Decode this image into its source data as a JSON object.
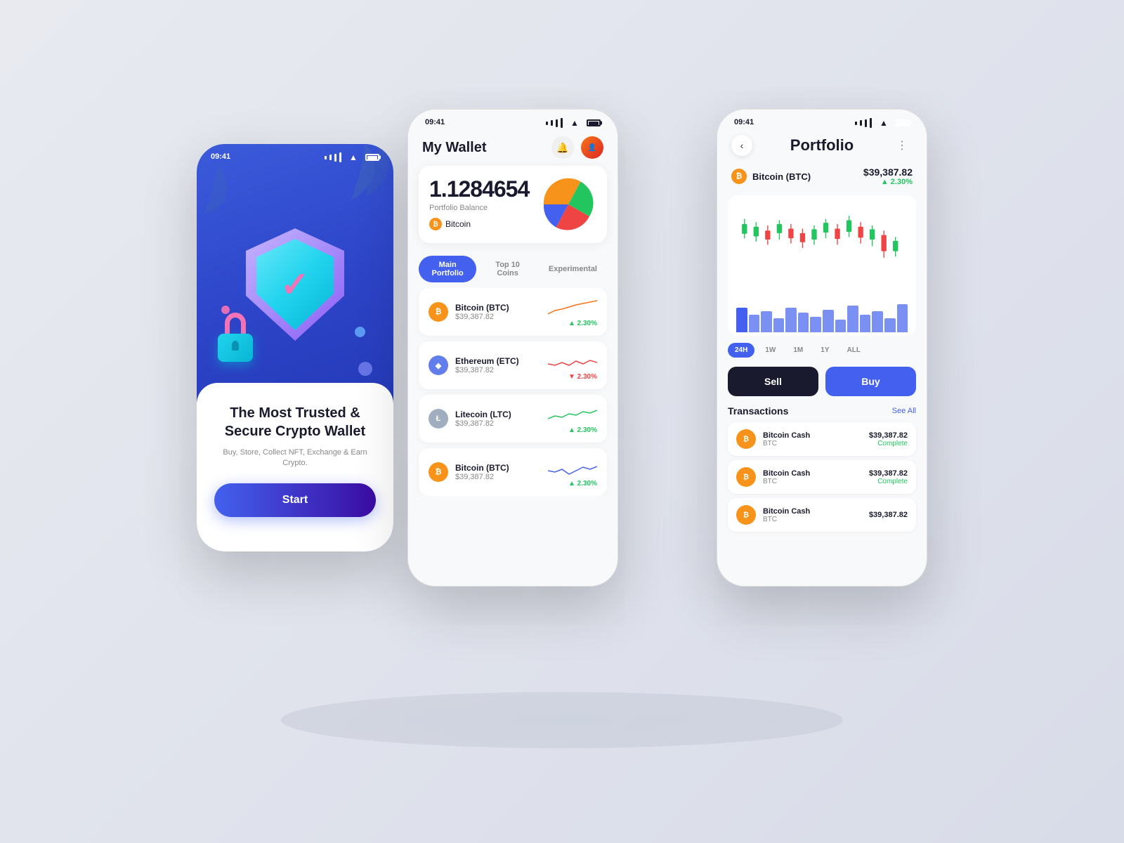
{
  "leftPhone": {
    "statusTime": "09:41",
    "headline": "The Most Trusted & Secure Crypto Wallet",
    "subtext": "Buy, Store, Collect NFT, Exchange & Earn Crypto.",
    "startBtn": "Start"
  },
  "middlePhone": {
    "statusTime": "09:41",
    "title": "My Wallet",
    "portfolio": {
      "balance": "1.1284654",
      "label": "Portfolio Balance",
      "currency": "Bitcoin"
    },
    "tabs": [
      "Main Portfolio",
      "Top 10 Coins",
      "Experimental"
    ],
    "activeTab": 0,
    "coins": [
      {
        "name": "Bitcoin (BTC)",
        "price": "$39,387.82",
        "change": "▲ 2.30%",
        "positive": true,
        "type": "btc"
      },
      {
        "name": "Ethereum (ETC)",
        "price": "$39,387.82",
        "change": "▼ 2.30%",
        "positive": false,
        "type": "eth"
      },
      {
        "name": "Litecoin (LTC)",
        "price": "$39,387.82",
        "change": "▲ 2.30%",
        "positive": true,
        "type": "ltc"
      },
      {
        "name": "Bitcoin (BTC)",
        "price": "$39,387.82",
        "change": "▲ 2.30%",
        "positive": true,
        "type": "btc2"
      }
    ]
  },
  "rightPhone": {
    "statusTime": "09:41",
    "title": "Portfolio",
    "btcName": "Bitcoin (BTC)",
    "btcPrice": "$39,387.82",
    "btcChange": "▲ 2.30%",
    "timeRanges": [
      "24H",
      "1W",
      "1M",
      "1Y",
      "ALL"
    ],
    "activeRange": 0,
    "sellLabel": "Sell",
    "buyLabel": "Buy",
    "transactionsTitle": "Transactions",
    "seeAllLabel": "See All",
    "transactions": [
      {
        "name": "Bitcoin Cash",
        "sub": "BTC",
        "amount": "$39,387.82",
        "status": "Complete"
      },
      {
        "name": "Bitcoin Cash",
        "sub": "BTC",
        "amount": "$39,387.82",
        "status": "Complete"
      },
      {
        "name": "Bitcoin Cash",
        "sub": "BTC",
        "amount": "$39,387.82",
        "status": ""
      }
    ]
  },
  "pieChart": {
    "segments": [
      {
        "color": "#f7931a",
        "percent": 30
      },
      {
        "color": "#22c55e",
        "percent": 30
      },
      {
        "color": "#ef4444",
        "percent": 20
      },
      {
        "color": "#4361ee",
        "percent": 20
      }
    ]
  }
}
